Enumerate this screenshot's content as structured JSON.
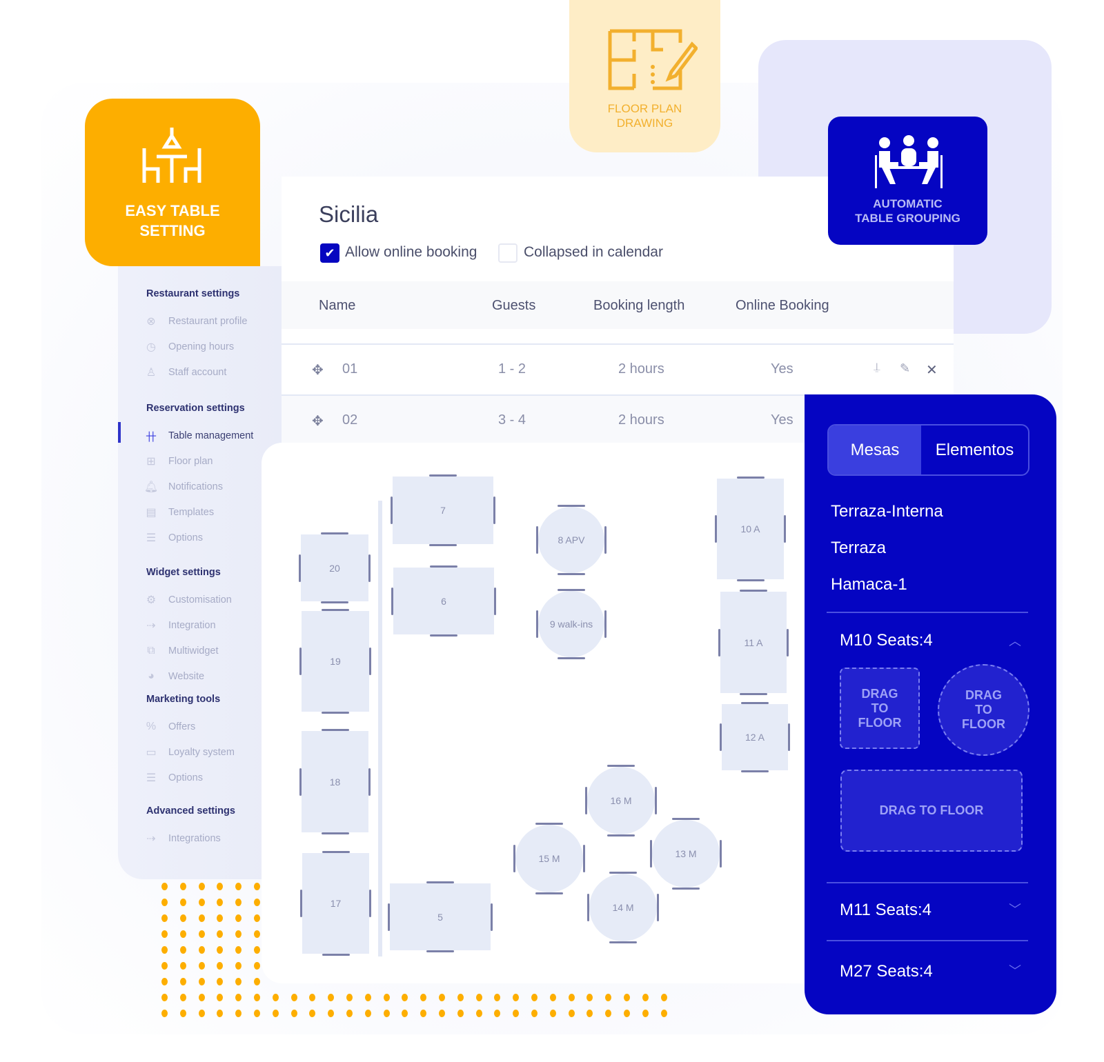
{
  "colors": {
    "orange": "#fdae00",
    "blue": "#0505c2",
    "lavender": "#e6e7fb",
    "cream": "#feedc6"
  },
  "badges": {
    "easy_table": {
      "line1": "EASY TABLE",
      "line2": "SETTING",
      "icon": "table-dining-icon"
    },
    "floor_plan": {
      "line1": "FLOOR PLAN",
      "line2": "DRAWING",
      "icon": "floor-plan-pencil-icon"
    },
    "auto_group": {
      "line1": "AUTOMATIC",
      "line2": "TABLE GROUPING",
      "icon": "people-meeting-icon"
    }
  },
  "sidebar": {
    "sections": [
      {
        "heading": "Restaurant settings",
        "items": [
          {
            "label": "Restaurant profile",
            "icon": "utensils-icon"
          },
          {
            "label": "Opening hours",
            "icon": "clock-icon"
          },
          {
            "label": "Staff account",
            "icon": "user-icon"
          }
        ]
      },
      {
        "heading": "Reservation settings",
        "items": [
          {
            "label": "Table management",
            "icon": "table-icon",
            "active": true
          },
          {
            "label": "Floor plan",
            "icon": "floor-plan-icon"
          },
          {
            "label": "Notifications",
            "icon": "bell-icon"
          },
          {
            "label": "Templates",
            "icon": "template-icon"
          },
          {
            "label": "Options",
            "icon": "list-icon"
          }
        ]
      },
      {
        "heading": "Widget settings",
        "items": [
          {
            "label": "Customisation",
            "icon": "gear-brush-icon"
          },
          {
            "label": "Integration",
            "icon": "plug-gear-icon"
          },
          {
            "label": "Multiwidget",
            "icon": "window-plus-icon"
          },
          {
            "label": "Website",
            "icon": "globe-icon"
          }
        ]
      },
      {
        "heading": "Marketing tools",
        "items": [
          {
            "label": "Offers",
            "icon": "percent-hand-icon"
          },
          {
            "label": "Loyalty system",
            "icon": "heart-card-icon"
          },
          {
            "label": "Options",
            "icon": "list-icon"
          }
        ]
      },
      {
        "heading": "Advanced settings",
        "items": [
          {
            "label": "Integrations",
            "icon": "plug-gear-icon"
          }
        ]
      }
    ]
  },
  "main": {
    "title": "Sicilia",
    "allow_online_booking": {
      "label": "Allow online booking",
      "checked": true
    },
    "collapsed_in_calendar": {
      "label": "Collapsed in calendar",
      "checked": false
    },
    "columns": [
      "Name",
      "Guests",
      "Booking length",
      "Online Booking"
    ],
    "rows": [
      {
        "name": "01",
        "guests": "1 - 2",
        "length": "2 hours",
        "online": "Yes"
      },
      {
        "name": "02",
        "guests": "3 - 4",
        "length": "2 hours",
        "online": "Yes"
      }
    ]
  },
  "floor": {
    "tables": [
      "7",
      "20",
      "6",
      "19",
      "18",
      "17",
      "5",
      "8 APV",
      "9  walk-ins",
      "10 A",
      "11 A",
      "12 A",
      "16 M",
      "15 M",
      "13 M",
      "14 M"
    ]
  },
  "panel": {
    "tabs": [
      {
        "label": "Mesas",
        "active": true
      },
      {
        "label": "Elementos",
        "active": false
      }
    ],
    "zones": [
      "Terraza-Interna",
      "Terraza",
      "Hamaca-1"
    ],
    "tables": [
      {
        "label": "M10 Seats:4",
        "expanded": true
      },
      {
        "label": "M11 Seats:4",
        "expanded": false
      },
      {
        "label": "M27 Seats:4",
        "expanded": false
      }
    ],
    "drag_square": "DRAG TO FLOOR",
    "drag_round": "DRAG TO FLOOR",
    "drag_wide": "DRAG TO  FLOOR"
  }
}
